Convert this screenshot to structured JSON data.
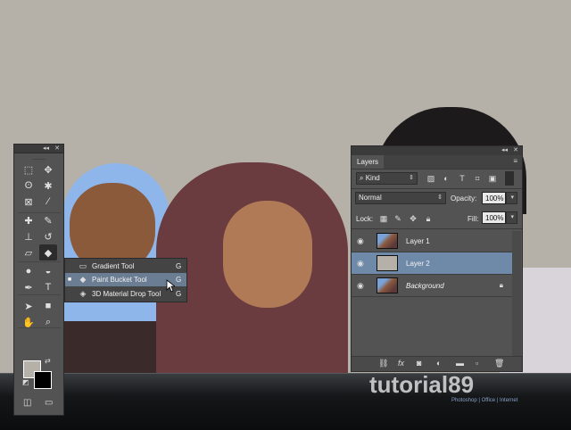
{
  "tools_panel": {
    "collapse_glyph": "◂◂",
    "close_glyph": "✕",
    "tools": [
      {
        "name": "rect-marquee-icon",
        "glyph": "⬚"
      },
      {
        "name": "move-icon",
        "glyph": "✥"
      },
      {
        "name": "lasso-icon",
        "glyph": "ʘ"
      },
      {
        "name": "magic-wand-icon",
        "glyph": "✱"
      },
      {
        "name": "crop-icon",
        "glyph": "⊠"
      },
      {
        "name": "eyedropper-icon",
        "glyph": "⁄"
      },
      {
        "name": "spot-healing-icon",
        "glyph": "✚"
      },
      {
        "name": "brush-icon",
        "glyph": "✎"
      },
      {
        "name": "clone-stamp-icon",
        "glyph": "⊥"
      },
      {
        "name": "history-brush-icon",
        "glyph": "↺"
      },
      {
        "name": "eraser-icon",
        "glyph": "▱"
      },
      {
        "name": "paint-bucket-icon",
        "glyph": "◆"
      },
      {
        "name": "blur-icon",
        "glyph": "●"
      },
      {
        "name": "dodge-icon",
        "glyph": "◒"
      },
      {
        "name": "pen-icon",
        "glyph": "✒"
      },
      {
        "name": "type-icon",
        "glyph": "T"
      },
      {
        "name": "path-selection-icon",
        "glyph": "➤"
      },
      {
        "name": "rectangle-shape-icon",
        "glyph": "■"
      },
      {
        "name": "hand-icon",
        "glyph": "✋"
      },
      {
        "name": "zoom-icon",
        "glyph": "⌕"
      }
    ],
    "foreground_color": "#b5b1a8",
    "background_color": "#000000",
    "quick_mask_glyph": "◫",
    "screen_mode_glyph": "▭"
  },
  "flyout": {
    "items": [
      {
        "label": "Gradient Tool",
        "key": "G",
        "icon": "gradient-icon",
        "glyph": "▭",
        "bullet": ""
      },
      {
        "label": "Paint Bucket Tool",
        "key": "G",
        "icon": "paint-bucket-icon",
        "glyph": "◆",
        "bullet": "■"
      },
      {
        "label": "3D Material Drop Tool",
        "key": "G",
        "icon": "3d-material-drop-icon",
        "glyph": "◈",
        "bullet": ""
      }
    ]
  },
  "layers_panel": {
    "tab_label": "Layers",
    "collapse_glyph": "◂◂",
    "close_glyph": "✕",
    "menu_glyph": "≡",
    "filter_kind": "Kind",
    "filter_prefix": "⌕",
    "blend_mode": "Normal",
    "opacity_label": "Opacity:",
    "opacity_value": "100%",
    "lock_label": "Lock:",
    "fill_label": "Fill:",
    "fill_value": "100%",
    "layers": [
      {
        "name": "Layer 1",
        "italic": false,
        "selected": false,
        "thumb": "photo",
        "locked": false
      },
      {
        "name": "Layer 2",
        "italic": false,
        "selected": true,
        "thumb": "#b5b1a8",
        "locked": false
      },
      {
        "name": "Background",
        "italic": true,
        "selected": false,
        "thumb": "photo",
        "locked": true
      }
    ],
    "footer_icons": [
      "link-icon",
      "fx-icon",
      "mask-icon",
      "adjustment-icon",
      "folder-icon",
      "new-layer-icon",
      "trash-icon"
    ]
  },
  "watermark": {
    "text": "tutorial89",
    "tagline": "Photoshop | Office | Internet"
  }
}
